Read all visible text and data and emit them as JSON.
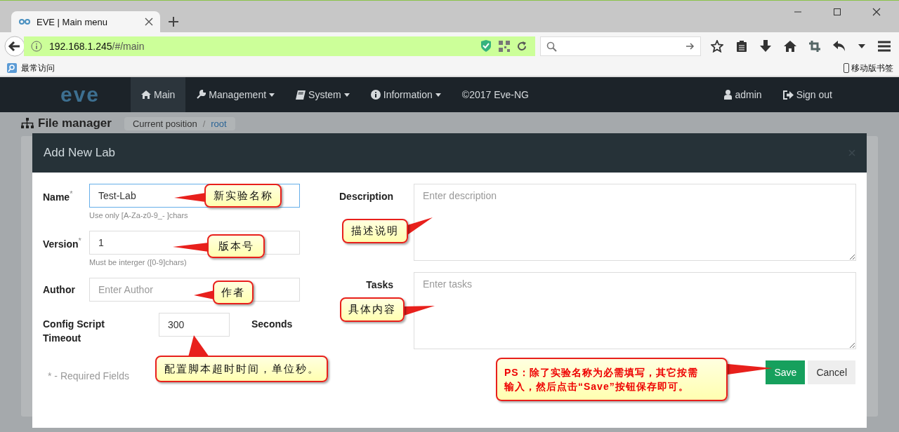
{
  "browser": {
    "tab_title": "EVE | Main menu",
    "address": {
      "host": "192.168.1.245",
      "path": "/#/main"
    },
    "bookmarks": [
      {
        "label": "最常访问"
      }
    ],
    "mobile_bookmarks": "移动版书签"
  },
  "navbar": {
    "logo": "eve",
    "items": [
      {
        "label": "Main",
        "selected": true,
        "dropdown": false
      },
      {
        "label": "Management",
        "selected": false,
        "dropdown": true
      },
      {
        "label": "System",
        "selected": false,
        "dropdown": true
      },
      {
        "label": "Information",
        "selected": false,
        "dropdown": true
      }
    ],
    "copyright": "©2017 Eve-NG",
    "user": "admin",
    "sign_out": "Sign out"
  },
  "page": {
    "title": "File manager",
    "breadcrumb_separator": "/",
    "breadcrumb": [
      {
        "label": "Current position",
        "link": false
      },
      {
        "label": "root",
        "link": true
      }
    ]
  },
  "modal": {
    "title": "Add New Lab",
    "left_fields": [
      {
        "label": "Name",
        "mark": "*",
        "value": "Test-Lab",
        "focused": true,
        "help": "Use only [A-Za-z0-9_- ]chars"
      },
      {
        "label": "Version",
        "mark": "*",
        "value": "1",
        "focused": false,
        "help": "Must be interger ([0-9]chars)"
      },
      {
        "label": "Author",
        "placeholder": "Enter Author",
        "focused": false
      }
    ],
    "timeout": {
      "label": "Config Script Timeout",
      "value": "300",
      "unit": "Seconds"
    },
    "right_fields": [
      {
        "label": "Description",
        "placeholder": "Enter description"
      },
      {
        "label": "Tasks",
        "placeholder": "Enter tasks"
      }
    ],
    "required_note": "* - Required Fields",
    "buttons": [
      {
        "label": "Save",
        "kind": "primary"
      },
      {
        "label": "Cancel",
        "kind": "default"
      }
    ]
  },
  "callouts": [
    {
      "text": "新实验名称",
      "kind": "note"
    },
    {
      "text": "版本号",
      "kind": "note"
    },
    {
      "text": "作者",
      "kind": "note"
    },
    {
      "text": "配置脚本超时时间，单位秒。",
      "kind": "note"
    },
    {
      "text": "描述说明",
      "kind": "note"
    },
    {
      "text": "具体内容",
      "kind": "note"
    },
    {
      "text": "**PS：**除了实验名称为必需填写，其它按需输入，然后点击“**Save**”按钮保存即可。",
      "kind": "warning"
    }
  ]
}
